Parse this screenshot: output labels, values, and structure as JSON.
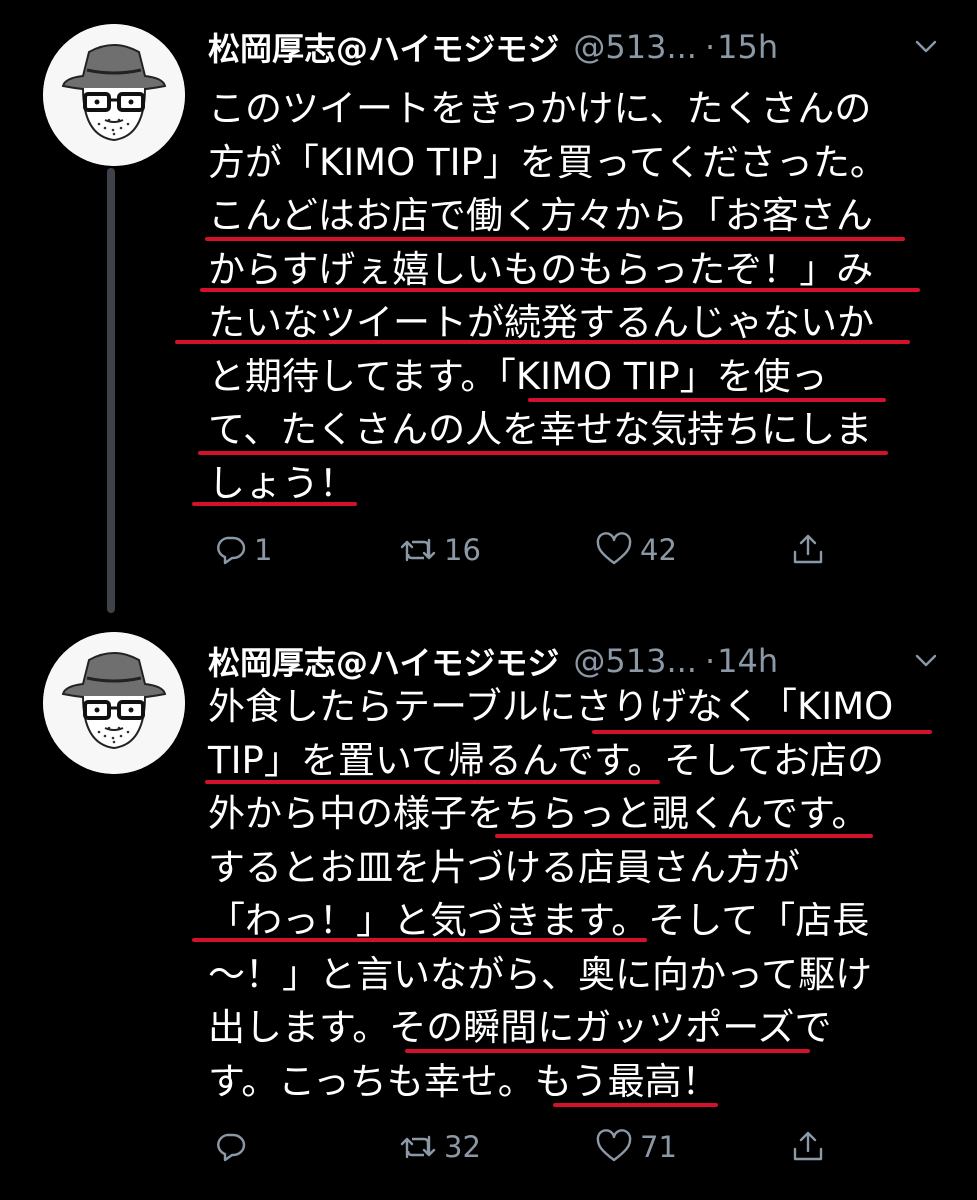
{
  "tweets": [
    {
      "author_name": "松岡厚志@ハイモジモジ",
      "handle": "@513...",
      "dot": "·",
      "time": "15h",
      "lines": [
        "このツイートをきっかけに、たくさんの",
        "方が「KIMO TIP」を買ってくださった。",
        "こんどはお店で働く方々から「お客さん",
        "からすげぇ嬉しいものもらったぞ！」み",
        "たいなツイートが続発するんじゃないか",
        "と期待してます。「KIMO TIP」を使っ",
        "て、たくさんの人を幸せな気持ちにしま",
        "しょう！"
      ],
      "reply_count": "1",
      "retweet_count": "16",
      "like_count": "42"
    },
    {
      "author_name": "松岡厚志@ハイモジモジ",
      "handle": "@513...",
      "dot": "·",
      "time": "14h",
      "lines": [
        "外食したらテーブルにさりげなく「KIMO",
        "TIP」を置いて帰るんです。そしてお店の",
        "外から中の様子をちらっと覗くんです。",
        "するとお皿を片づける店員さん方が",
        "「わっ！」と気づきます。そして「店長",
        "〜！」と言いながら、奥に向かって駆け",
        "出します。その瞬間にガッツポーズで",
        "す。こっちも幸せ。もう最高！"
      ],
      "reply_count": "",
      "retweet_count": "32",
      "like_count": "71"
    }
  ],
  "colors": {
    "background": "#000000",
    "text": "#ffffff",
    "secondary": "#8b98a5",
    "underline": "#d3112a",
    "thread_line": "#3d4348"
  },
  "icons": [
    "reply-icon",
    "retweet-icon",
    "like-icon",
    "share-icon",
    "chevron-down-icon"
  ]
}
